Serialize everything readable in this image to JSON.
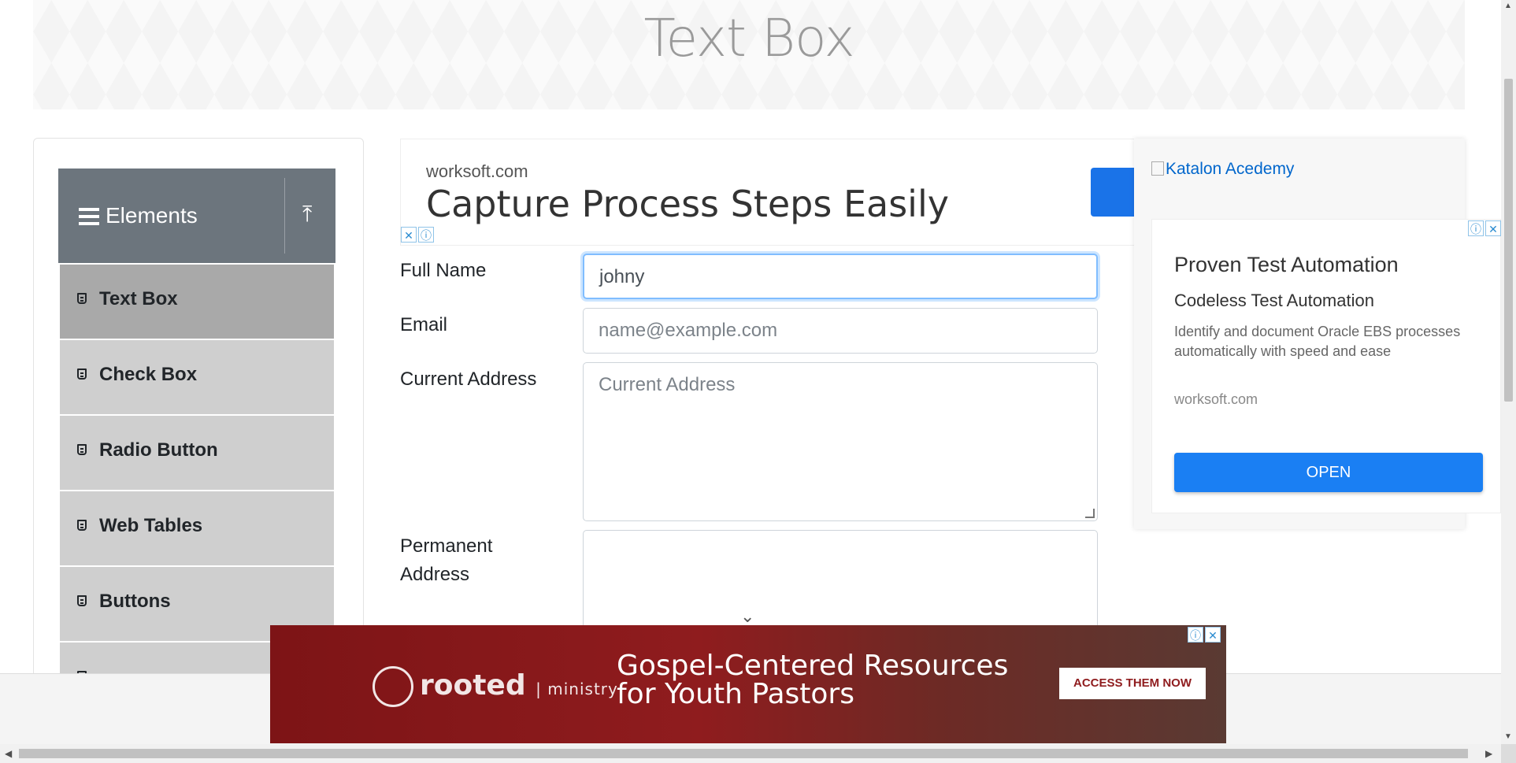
{
  "page": {
    "title": "Text Box"
  },
  "sidebar": {
    "header": {
      "title": "Elements",
      "menu_icon": "hamburger-icon",
      "collapse_icon": "upload-arrow-icon"
    },
    "items": [
      {
        "label": "Text Box",
        "active": true,
        "icon": "html5-icon"
      },
      {
        "label": "Check Box",
        "active": false,
        "icon": "html5-icon"
      },
      {
        "label": "Radio Button",
        "active": false,
        "icon": "html5-icon"
      },
      {
        "label": "Web Tables",
        "active": false,
        "icon": "html5-icon"
      },
      {
        "label": "Buttons",
        "active": false,
        "icon": "html5-icon"
      }
    ]
  },
  "ad_top": {
    "site": "worksoft.com",
    "headline": "Capture Process Steps Easily",
    "adchoices": [
      "✕",
      "ⓘ"
    ]
  },
  "form": {
    "full_name": {
      "label": "Full Name",
      "value": "johny"
    },
    "email": {
      "label": "Email",
      "placeholder": "name@example.com"
    },
    "current_address": {
      "label": "Current Address",
      "placeholder": "Current Address"
    },
    "permanent_address": {
      "label_line1": "Permanent",
      "label_line2": "Address"
    }
  },
  "ad_right": {
    "image_alt": "Katalon Acedemy",
    "heading": "Proven Test Automation",
    "subheading": "Codeless Test Automation",
    "description": "Identify and document Oracle EBS processes automatically with speed and ease",
    "site": "worksoft.com",
    "button": "OPEN",
    "adchoices": [
      "ⓘ",
      "✕"
    ]
  },
  "ad_bottom": {
    "brand": "rooted",
    "brand_sub": "| ministry",
    "tagline_line1": "Gospel-Centered Resources",
    "tagline_line2": "for Youth Pastors",
    "cta": "ACCESS THEM NOW",
    "adchoices": [
      "ⓘ",
      "✕"
    ]
  },
  "colors": {
    "sidebar_header": "#6c757d",
    "active_item": "#a9a9a9",
    "item": "#cfcfcf",
    "ad_button": "#1a7ff3",
    "bottom_ad": "#8f1c1e"
  }
}
